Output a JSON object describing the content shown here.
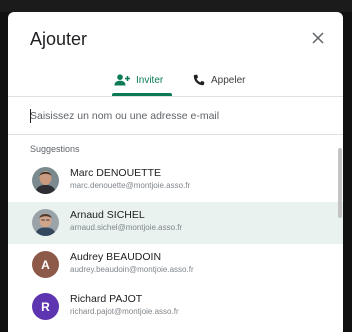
{
  "dialog": {
    "title": "Ajouter",
    "close_icon": "close-icon"
  },
  "tabs": [
    {
      "label": "Inviter",
      "icon": "person-add-icon",
      "active": true
    },
    {
      "label": "Appeler",
      "icon": "phone-icon",
      "active": false
    }
  ],
  "search": {
    "placeholder": "Saisissez un nom ou une adresse e-mail",
    "value": ""
  },
  "suggestions": {
    "label": "Suggestions",
    "items": [
      {
        "name": "Marc DENOUETTE",
        "email": "marc.denouette@montjoie.asso.fr",
        "avatar": "photo",
        "highlighted": false
      },
      {
        "name": "Arnaud SICHEL",
        "email": "arnaud.sichel@montjoie.asso.fr",
        "avatar": "photo",
        "highlighted": true
      },
      {
        "name": "Audrey BEAUDOIN",
        "email": "audrey.beaudoin@montjoie.asso.fr",
        "avatar": "A",
        "avatar_color": "#8d5a4a",
        "highlighted": false
      },
      {
        "name": "Richard PAJOT",
        "email": "richard.pajot@montjoie.asso.fr",
        "avatar": "R",
        "avatar_color": "#5e35b1",
        "highlighted": false
      }
    ]
  },
  "colors": {
    "accent": "#0b7a55",
    "highlight_row": "#e9f2ef"
  }
}
